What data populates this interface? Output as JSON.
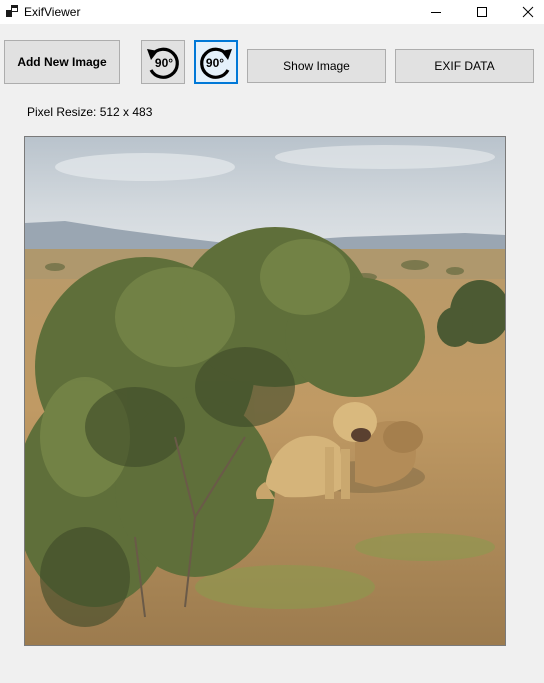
{
  "window": {
    "title": "ExifViewer"
  },
  "toolbar": {
    "add_label": "Add New Image",
    "rotate_left_label": "90°",
    "rotate_right_label": "90°",
    "show_label": "Show Image",
    "exif_label": "EXIF DATA"
  },
  "info": {
    "pixel_resize": "Pixel Resize: 512 x 483"
  },
  "icons": {
    "app": "app-window-icon",
    "minimize": "minimize-icon",
    "maximize": "maximize-icon",
    "close": "close-icon",
    "rotate_left": "rotate-counterclockwise-icon",
    "rotate_right": "rotate-clockwise-icon"
  },
  "colors": {
    "focus_border": "#0078d7",
    "button_face": "#e1e1e1",
    "window_bg": "#f0f0f0"
  }
}
